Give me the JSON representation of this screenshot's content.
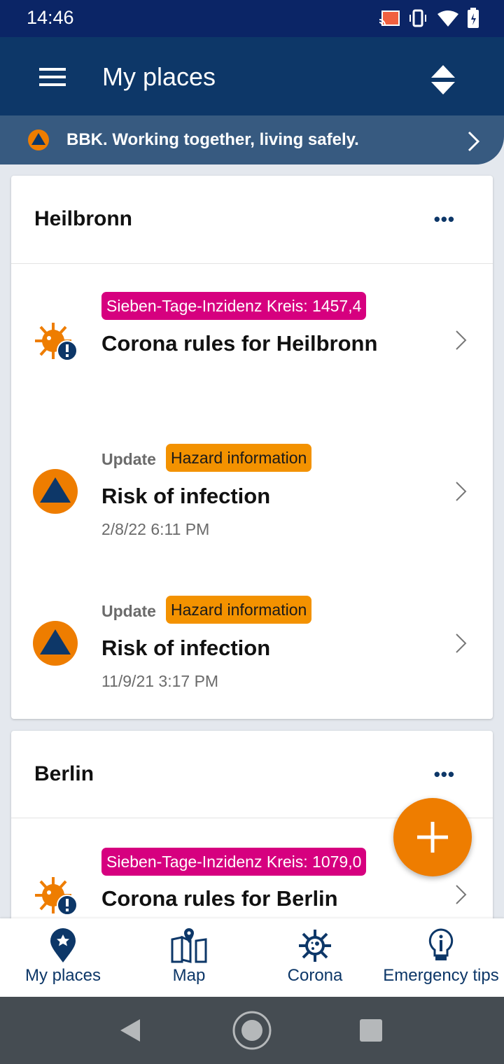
{
  "status_bar": {
    "time": "14:46",
    "icons": [
      "cast-icon",
      "vibrate-icon",
      "wifi-icon",
      "battery-charging-icon"
    ]
  },
  "app_bar": {
    "title": "My places",
    "menu_icon": "hamburger-menu-icon",
    "sort_icon": "sort-icon"
  },
  "banner": {
    "text": "BBK. Working together, living safely.",
    "icon": "bbk-logo-icon"
  },
  "places": [
    {
      "name": "Heilbronn",
      "items": [
        {
          "type": "corona",
          "tag": "Sieben-Tage-Inzidenz Kreis: 1457,4",
          "title": "Corona rules for Heilbronn"
        },
        {
          "type": "warning",
          "label": "Update",
          "tag": "Hazard information",
          "title": "Risk of infection",
          "date": "2/8/22 6:11 PM"
        },
        {
          "type": "warning",
          "label": "Update",
          "tag": "Hazard information",
          "title": "Risk of infection",
          "date": "11/9/21 3:17 PM"
        }
      ]
    },
    {
      "name": "Berlin",
      "items": [
        {
          "type": "corona",
          "tag": "Sieben-Tage-Inzidenz Kreis: 1079,0",
          "title": "Corona rules for Berlin"
        }
      ]
    }
  ],
  "more_label": "•••",
  "bottom_nav": [
    {
      "label": "My places",
      "active": true
    },
    {
      "label": "Map"
    },
    {
      "label": "Corona"
    },
    {
      "label": "Emergency tips"
    }
  ],
  "colors": {
    "primary": "#0d3768",
    "status_bar": "#0b2566",
    "banner": "#375a80",
    "magenta": "#d6007f",
    "orange": "#f39200",
    "fab": "#ee7d00"
  }
}
